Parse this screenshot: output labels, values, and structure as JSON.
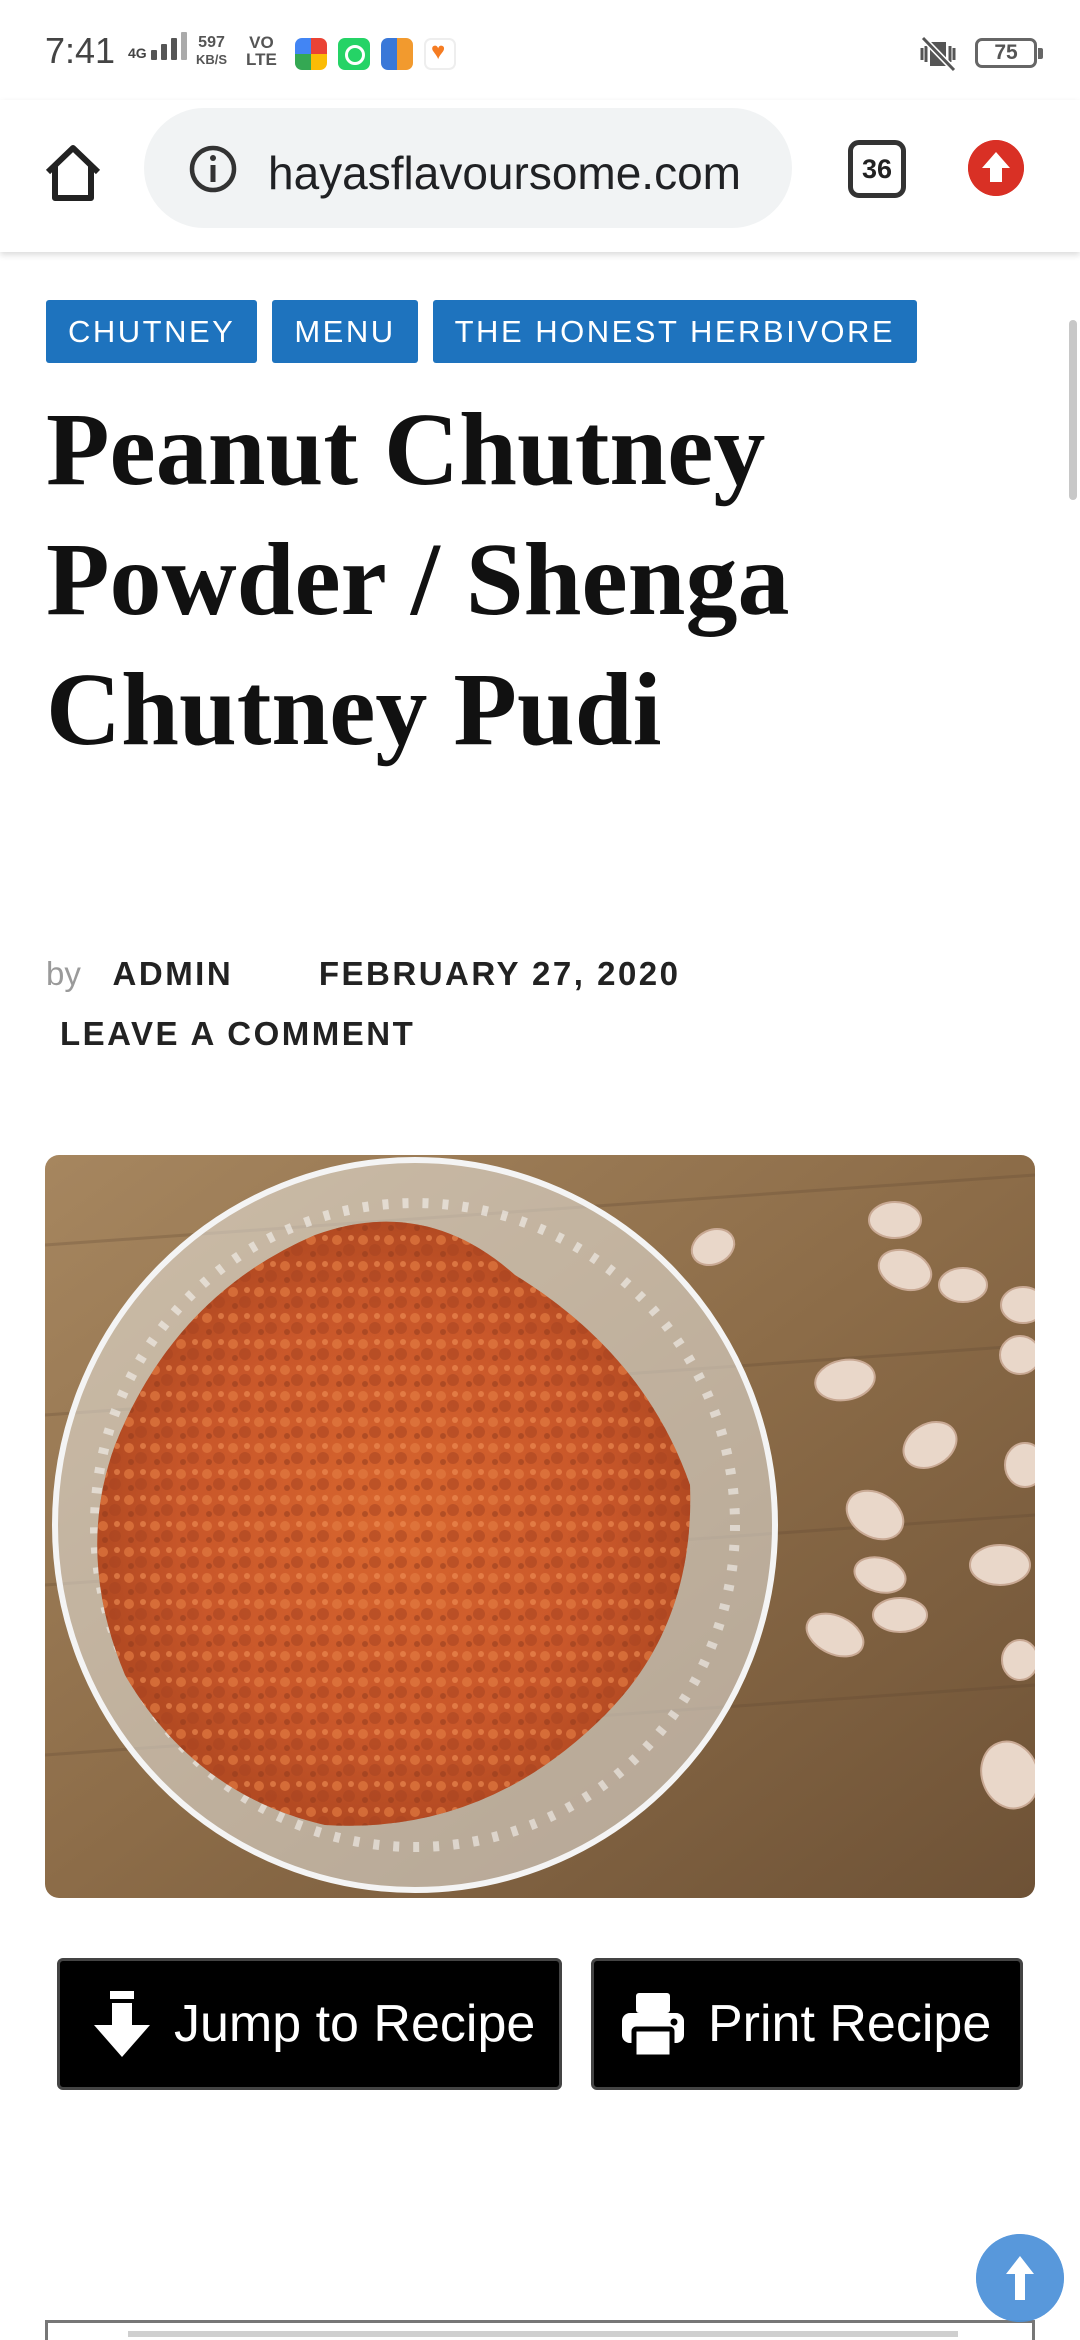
{
  "status_bar": {
    "time": "7:41",
    "network": "4G",
    "speed_value": "597",
    "speed_unit": "KB/S",
    "volte_top": "VO",
    "volte_bottom": "LTE",
    "battery": "75",
    "app_icons": [
      "photos-icon",
      "whatsapp-icon",
      "calculator-icon",
      "heart-app-icon"
    ]
  },
  "browser": {
    "url": "hayasflavoursome.com",
    "tab_count": "36"
  },
  "post": {
    "categories": [
      "CHUTNEY",
      "MENU",
      "THE HONEST HERBIVORE"
    ],
    "title": "Peanut Chutney Powder / Shenga Chutney Pudi",
    "by_label": "by",
    "author": "ADMIN",
    "date": "FEBRUARY 27, 2020",
    "comment_link": "LEAVE A COMMENT"
  },
  "recipe_buttons": {
    "jump": "Jump to Recipe",
    "print": "Print Recipe"
  },
  "colors": {
    "tag_bg": "#1e73be",
    "fab": "#4a90d9",
    "update": "#d93025"
  }
}
